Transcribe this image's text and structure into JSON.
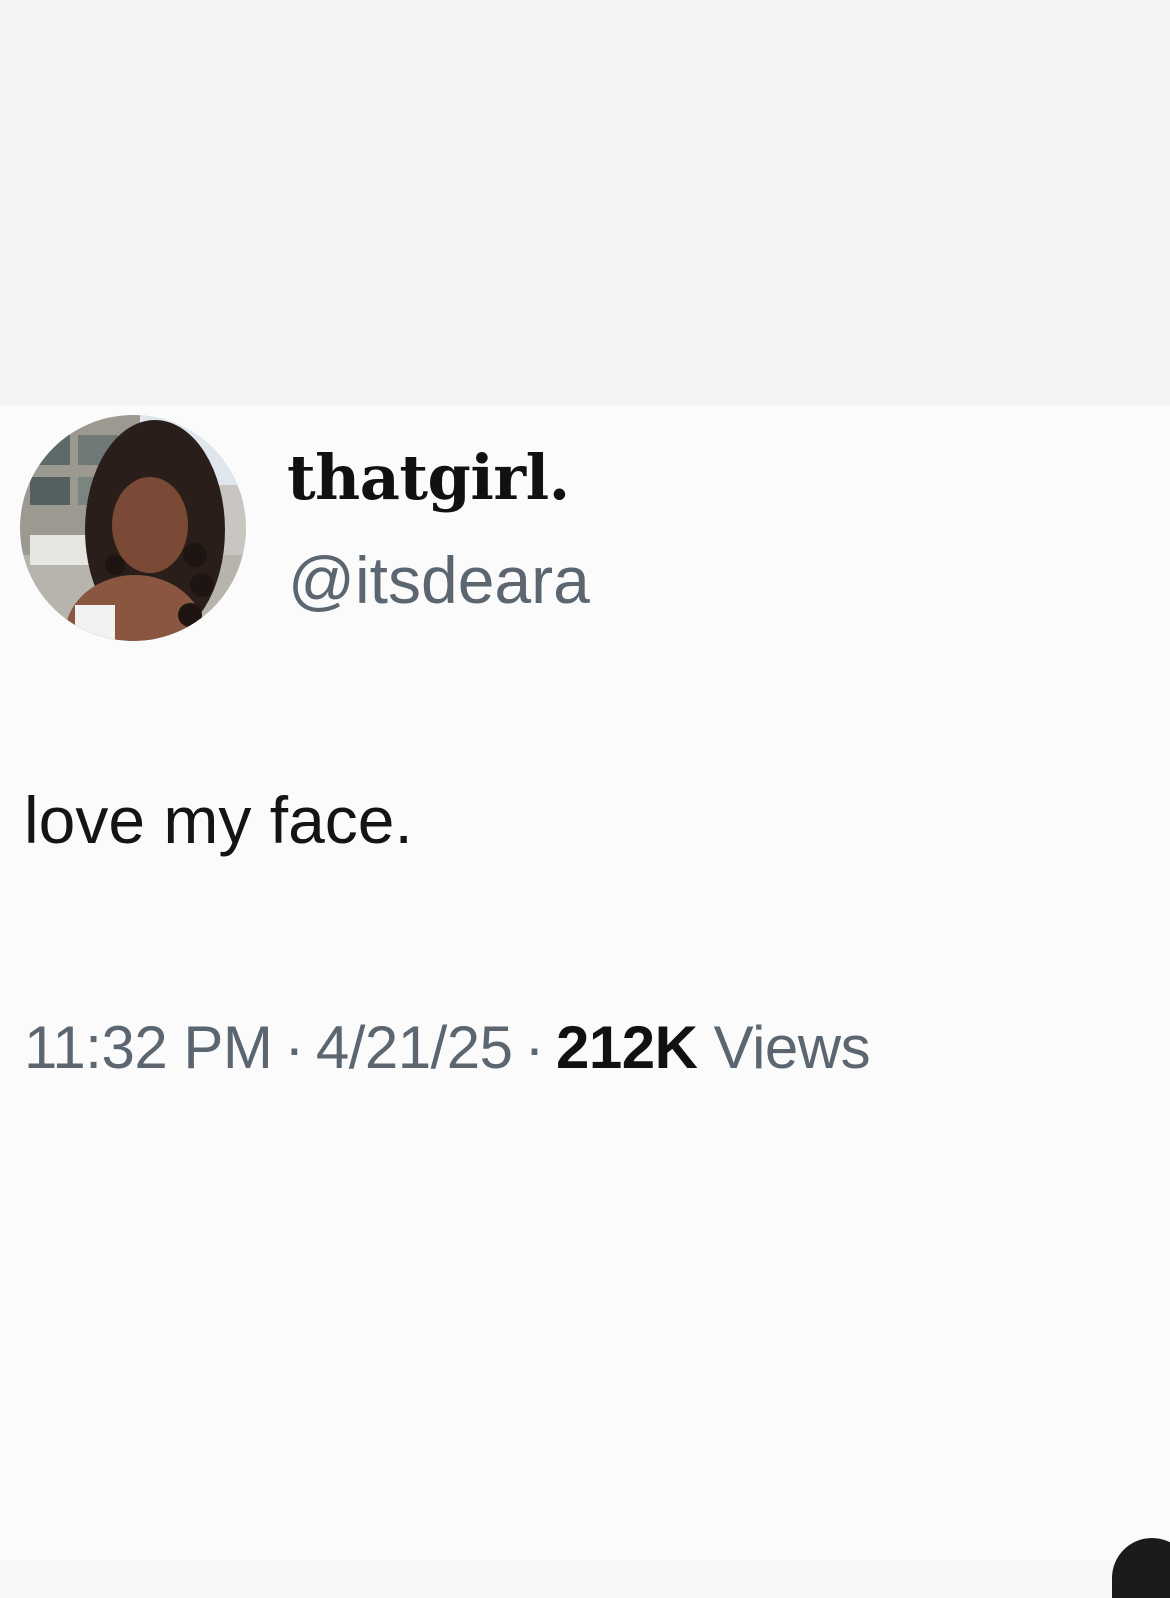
{
  "tweet": {
    "display_name": "thatgirl.",
    "handle": "@itsdeara",
    "text": "love my face.",
    "time": "11:32 PM",
    "separator": "·",
    "date": "4/21/25",
    "views_count": "212K",
    "views_label": "Views"
  },
  "icons": {
    "avatar": "profile-photo"
  },
  "colors": {
    "background": "#fbfbfc",
    "primary_text": "#111111",
    "secondary_text": "#5b6670"
  }
}
